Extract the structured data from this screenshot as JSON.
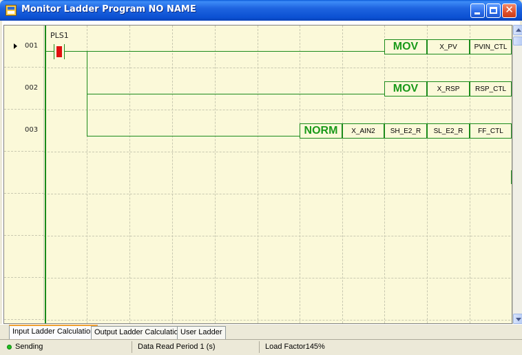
{
  "window": {
    "title": "Monitor Ladder Program NO NAME",
    "buttons": {
      "minimize": "minimize",
      "maximize": "maximize",
      "close": "✕"
    }
  },
  "ladder": {
    "rows": [
      {
        "number": "001"
      },
      {
        "number": "002"
      },
      {
        "number": "003"
      }
    ],
    "contact": {
      "label": "PLS1",
      "state": "on"
    },
    "rung1": {
      "instruction": "MOV",
      "operand1": "X_PV",
      "operand2": "PVIN_CTL"
    },
    "rung2": {
      "instruction": "MOV",
      "operand1": "X_RSP",
      "operand2": "RSP_CTL"
    },
    "rung3": {
      "instruction": "NORM",
      "operand1": "X_AIN2",
      "operand2": "SH_E2_R",
      "operand3": "SL_E2_R",
      "operand4": "FF_CTL"
    }
  },
  "tabs": [
    {
      "label": "Input Ladder Calculation",
      "active": true
    },
    {
      "label": "Output Ladder Calculation",
      "active": false
    },
    {
      "label": "User Ladder",
      "active": false
    }
  ],
  "status": {
    "connection": "Sending",
    "read_period": "Data Read Period 1 (s)",
    "load_factor": "Load Factor145%"
  },
  "colors": {
    "title_bar": "#0a5ad8",
    "grid_background": "#fbf9d9",
    "wire": "#1a8a1a",
    "contact_active": "#e01010",
    "status_ok": "#20c020"
  }
}
